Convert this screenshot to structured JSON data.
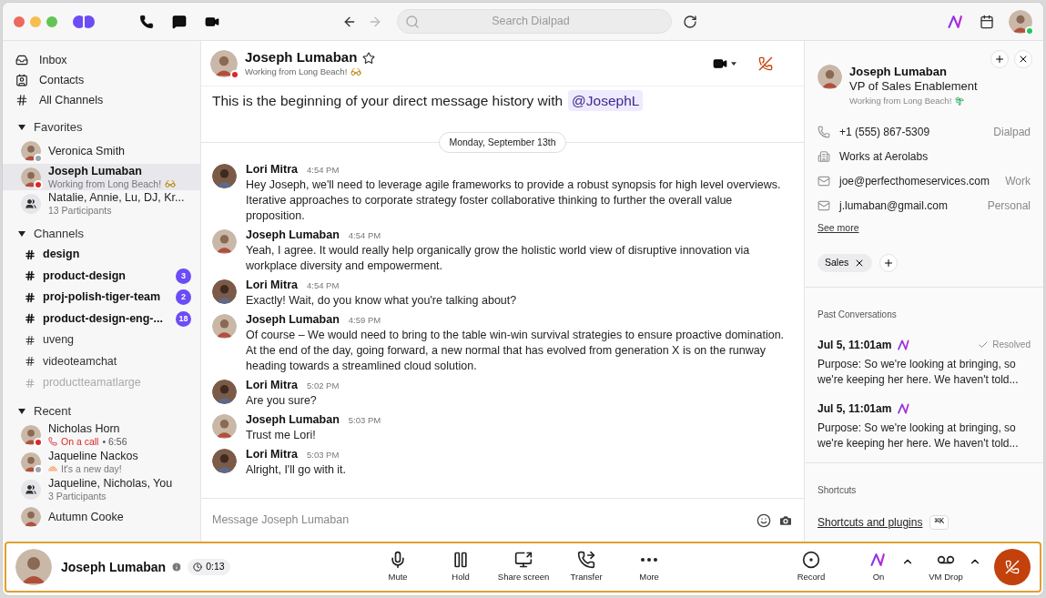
{
  "toolbar": {
    "search": {
      "placeholder": "Search Dialpad"
    },
    "color": "#22c55e"
  },
  "sidebar": {
    "nav": [
      {
        "kind": "inbox",
        "label": "Inbox"
      },
      {
        "kind": "contacts",
        "label": "Contacts"
      },
      {
        "kind": "channels",
        "label": "All Channels"
      }
    ],
    "favorites": {
      "title": "Favorites",
      "expanded": true,
      "items": [
        {
          "kind": "person",
          "name": "Veronica Smith",
          "color": "#9ca3af",
          "selected": false
        },
        {
          "kind": "person",
          "name": "Joseph Lumaban",
          "status": {
            "kind": "sunglasses",
            "text": "Working from Long Beach!"
          },
          "color": "#dc2626",
          "selected": true
        },
        {
          "kind": "group",
          "name": "Natalie, Annie, Lu, DJ, Kr...",
          "status": {
            "kind": "plain",
            "text": "13 Participants"
          },
          "selected": false
        }
      ]
    },
    "channels": {
      "title": "Channels",
      "expanded": true,
      "items": [
        {
          "name": "design",
          "unread": true,
          "muted": false
        },
        {
          "name": "product-design",
          "unread": true,
          "muted": false,
          "count": "3"
        },
        {
          "name": "proj-polish-tiger-team",
          "unread": true,
          "muted": false,
          "count": "2"
        },
        {
          "name": "product-design-eng-...",
          "unread": true,
          "muted": false,
          "count": "18"
        },
        {
          "name": "uveng",
          "unread": false,
          "muted": false
        },
        {
          "name": "videoteamchat",
          "unread": false,
          "muted": false
        },
        {
          "name": "productteamatlarge",
          "unread": false,
          "muted": true
        }
      ]
    },
    "recent": {
      "title": "Recent",
      "expanded": true,
      "items": [
        {
          "kind": "person",
          "name": "Nicholas Horn",
          "status": {
            "kind": "call",
            "text": "On a call",
            "duration": "• 6:56"
          },
          "color": "#dc2626"
        },
        {
          "kind": "person",
          "name": "Jaqueline Nackos",
          "status": {
            "kind": "rainbow",
            "text": "It's a new day!"
          },
          "color": "#9ca3af"
        },
        {
          "kind": "group",
          "name": "Jaqueline, Nicholas, You",
          "status": {
            "kind": "plain",
            "text": "3 Participants"
          }
        },
        {
          "kind": "person",
          "name": "Autumn Cooke"
        }
      ]
    }
  },
  "chat": {
    "name": "Joseph Lumaban",
    "status": "Working from Long Beach!",
    "color": "#dc2626",
    "starred": false,
    "intro": "This is the beginning of your direct message history with",
    "mention": "@JosephL",
    "date": "Monday, September 13th",
    "messages": [
      {
        "author": "Lori Mitra",
        "kind": "lori",
        "time": "4:54 PM",
        "text": "Hey Joseph, we'll need to leverage agile frameworks to provide a robust synopsis for high level overviews. Iterative approaches to corporate strategy foster collaborative thinking to further the overall value proposition."
      },
      {
        "author": "Joseph Lumaban",
        "kind": "joseph",
        "time": "4:54 PM",
        "text": "Yeah, I agree. It would really help organically grow the holistic world view of disruptive innovation via workplace diversity and empowerment."
      },
      {
        "author": "Lori Mitra",
        "kind": "lori",
        "time": "4:54 PM",
        "text": "Exactly! Wait, do you know what you're talking about?"
      },
      {
        "author": "Joseph Lumaban",
        "kind": "joseph",
        "time": "4:59 PM",
        "text": "Of course – We would need to bring to the table win-win survival strategies to ensure proactive domination. At the end of the day, going forward, a new normal that has evolved from generation X is on the runway heading towards a streamlined cloud solution."
      },
      {
        "author": "Lori Mitra",
        "kind": "lori",
        "time": "5:02 PM",
        "text": "Are you sure?"
      },
      {
        "author": "Joseph Lumaban",
        "kind": "joseph",
        "time": "5:03 PM",
        "text": "Trust me Lori!"
      },
      {
        "author": "Lori Mitra",
        "kind": "lori",
        "time": "5:03 PM",
        "text": "Alright, I'll go with it."
      }
    ],
    "composer": {
      "placeholder": "Message Joseph Lumaban"
    }
  },
  "contact": {
    "name": "Joseph Lumaban",
    "title": "VP of Sales Enablement",
    "status": "Working from Long Beach!",
    "details": [
      {
        "kind": "phone",
        "text": "+1 (555) 867-5309",
        "label": "Dialpad"
      },
      {
        "kind": "company",
        "text": "Works at Aerolabs"
      },
      {
        "kind": "email",
        "text": "joe@perfecthomeservices.com",
        "label": "Work"
      },
      {
        "kind": "email",
        "text": "j.lumaban@gmail.com",
        "label": "Personal"
      }
    ],
    "see_more": "See more",
    "tags": [
      "Sales"
    ],
    "past_title": "Past Conversations",
    "past": [
      {
        "date": "Jul 5, 11:01am",
        "resolved": true,
        "resolved_label": "Resolved",
        "text": "Purpose: So we're looking at bringing, so we're keeping her here. We haven't told..."
      },
      {
        "date": "Jul 5, 11:01am",
        "resolved": false,
        "text": "Purpose: So we're looking at bringing, so we're keeping her here. We haven't told..."
      }
    ],
    "shortcuts_title": "Shortcuts",
    "shortcut_link": "Shortcuts and plugins",
    "shortcut_key": "⌘K"
  },
  "call_bar": {
    "name": "Joseph Lumaban",
    "timer": "0:13",
    "actions": [
      {
        "kind": "mute",
        "label": "Mute"
      },
      {
        "kind": "hold",
        "label": "Hold"
      },
      {
        "kind": "share",
        "label": "Share screen"
      },
      {
        "kind": "transfer",
        "label": "Transfer"
      },
      {
        "kind": "more",
        "label": "More"
      }
    ],
    "right_actions": [
      {
        "kind": "record",
        "label": "Record",
        "menu": false
      },
      {
        "kind": "ai",
        "label": "On",
        "menu": true
      },
      {
        "kind": "vmdrop",
        "label": "VM Drop",
        "menu": true
      }
    ]
  }
}
